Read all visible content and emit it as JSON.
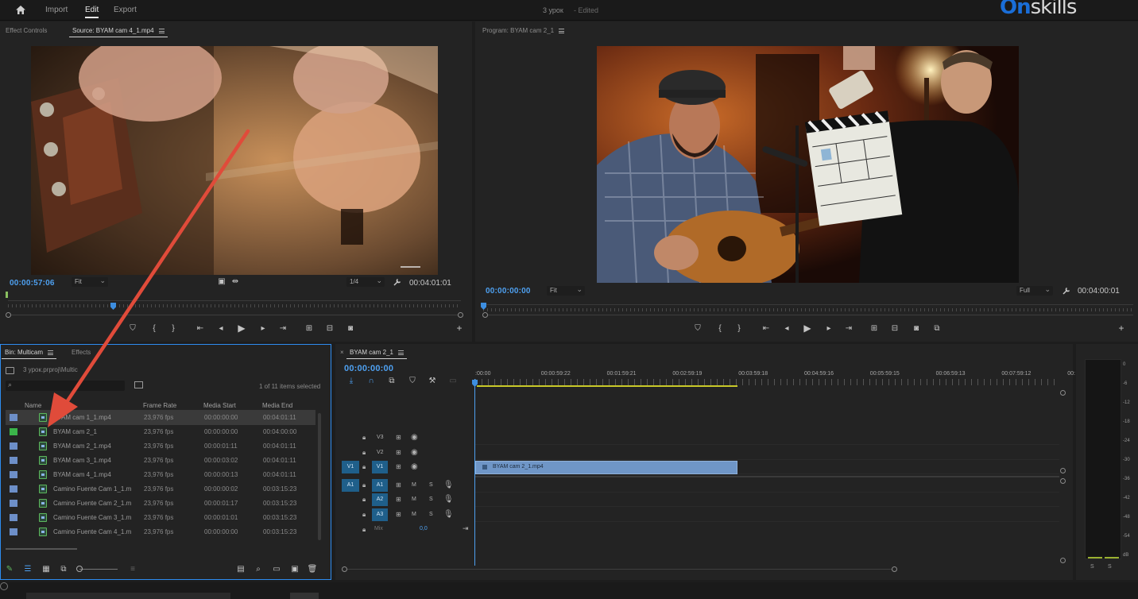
{
  "topbar": {
    "nav": [
      "Import",
      "Edit",
      "Export"
    ],
    "project_title": "3 урок",
    "project_status": "- Edited",
    "logo_a": "On",
    "logo_b": "skills"
  },
  "source": {
    "tabs": [
      "Effect Controls",
      "Source: BYAM cam 4_1.mp4"
    ],
    "timecode": "00:00:57:06",
    "fit": "Fit",
    "resolution": "1/4",
    "duration": "00:04:01:01"
  },
  "program": {
    "tab": "Program: BYAM cam 2_1",
    "timecode": "00:00:00:00",
    "fit": "Fit",
    "quality": "Full",
    "duration": "00:04:00:01"
  },
  "project": {
    "tabs": [
      "Bin: Multicam",
      "Effects"
    ],
    "path": "3 урок.prproj\\Multic",
    "items_selected": "1 of 11 items selected",
    "columns": [
      "Name",
      "Frame Rate",
      "Media Start",
      "Media End"
    ],
    "rows": [
      {
        "name": "BYAM cam 1_1.mp4",
        "rate": "23,976 fps",
        "start": "00:00:00:00",
        "end": "00:04:01:11",
        "green": false,
        "selected": true
      },
      {
        "name": "BYAM cam 2_1",
        "rate": "23,976 fps",
        "start": "00:00:00:00",
        "end": "00:04:00:00",
        "green": true,
        "selected": false
      },
      {
        "name": "BYAM cam 2_1.mp4",
        "rate": "23,976 fps",
        "start": "00:00:01:11",
        "end": "00:04:01:11",
        "green": false,
        "selected": false
      },
      {
        "name": "BYAM cam 3_1.mp4",
        "rate": "23,976 fps",
        "start": "00:00:03:02",
        "end": "00:04:01:11",
        "green": false,
        "selected": false
      },
      {
        "name": "BYAM cam 4_1.mp4",
        "rate": "23,976 fps",
        "start": "00:00:00:13",
        "end": "00:04:01:11",
        "green": false,
        "selected": false
      },
      {
        "name": "Camino Fuente Cam 1_1.m",
        "rate": "23,976 fps",
        "start": "00:00:00:02",
        "end": "00:03:15:23",
        "green": false,
        "selected": false
      },
      {
        "name": "Camino Fuente Cam 2_1.m",
        "rate": "23,976 fps",
        "start": "00:00:01:17",
        "end": "00:03:15:23",
        "green": false,
        "selected": false
      },
      {
        "name": "Camino Fuente Cam 3_1.m",
        "rate": "23,976 fps",
        "start": "00:00:01:01",
        "end": "00:03:15:23",
        "green": false,
        "selected": false
      },
      {
        "name": "Camino Fuente Cam 4_1.m",
        "rate": "23,976 fps",
        "start": "00:00:00:00",
        "end": "00:03:15:23",
        "green": false,
        "selected": false
      }
    ]
  },
  "timeline": {
    "tab": "BYAM cam 2_1",
    "timecode": "00:00:00:00",
    "ticks": [
      ":00:00",
      "00:00:59:22",
      "00:01:59:21",
      "00:02:59:19",
      "00:03:59:18",
      "00:04:59:16",
      "00:05:59:15",
      "00:06:59:13",
      "00:07:59:12",
      "00:"
    ],
    "video_tracks": [
      "V3",
      "V2",
      "V1"
    ],
    "audio_tracks": [
      "A1",
      "A2",
      "A3"
    ],
    "src_v": "V1",
    "src_a": "A1",
    "mute": "M",
    "solo": "S",
    "mix_label": "Mix",
    "mix_value": "0,0",
    "clip_label": "BYAM cam 2_1.mp4"
  },
  "meter": {
    "labels": [
      "0",
      "-6",
      "-12",
      "-18",
      "-24",
      "-30",
      "-36",
      "-42",
      "-48",
      "-54",
      "dB"
    ],
    "solo_labels": [
      "S",
      "S"
    ]
  },
  "colors": {
    "accent": "#2d8cf0",
    "timecode": "#4ea0f0",
    "arrow": "#e04b3a",
    "track_target": "#1f5f8a",
    "clip": "#6f96c7"
  }
}
